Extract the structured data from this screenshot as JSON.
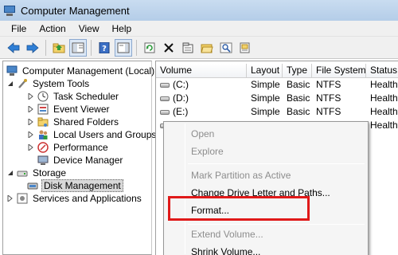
{
  "window": {
    "title": "Computer Management",
    "app_icon": "computer-management-icon"
  },
  "menu": [
    "File",
    "Action",
    "View",
    "Help"
  ],
  "toolbar": {
    "buttons": [
      "back-arrow-icon",
      "forward-arrow-icon",
      "up-folder-icon",
      "show-hide-tree-icon",
      "help-icon",
      "action-pane-icon",
      "refresh-icon",
      "delete-icon",
      "properties-icon",
      "open-folder-icon",
      "search-icon",
      "export-icon"
    ]
  },
  "tree": {
    "root": "Computer Management (Local)",
    "system_tools": "System Tools",
    "task_scheduler": "Task Scheduler",
    "event_viewer": "Event Viewer",
    "shared_folders": "Shared Folders",
    "local_users": "Local Users and Groups",
    "performance": "Performance",
    "device_manager": "Device Manager",
    "storage": "Storage",
    "disk_management": "Disk Management",
    "services": "Services and Applications"
  },
  "volumes": {
    "columns": [
      "Volume",
      "Layout",
      "Type",
      "File System",
      "Status"
    ],
    "rows": [
      [
        "(C:)",
        "Simple",
        "Basic",
        "NTFS",
        "Healthy"
      ],
      [
        "(D:)",
        "Simple",
        "Basic",
        "NTFS",
        "Healthy"
      ],
      [
        "(E:)",
        "Simple",
        "Basic",
        "NTFS",
        "Healthy"
      ],
      [
        "",
        "",
        "",
        "",
        "Healthy"
      ]
    ]
  },
  "context_menu": {
    "open": "Open",
    "explore": "Explore",
    "mark_active": "Mark Partition as Active",
    "change_letter": "Change Drive Letter and Paths...",
    "format": "Format...",
    "extend": "Extend Volume...",
    "shrink": "Shrink Volume..."
  },
  "colors": {
    "highlight": "#e01919",
    "selected_row": "#cfe3fc"
  }
}
